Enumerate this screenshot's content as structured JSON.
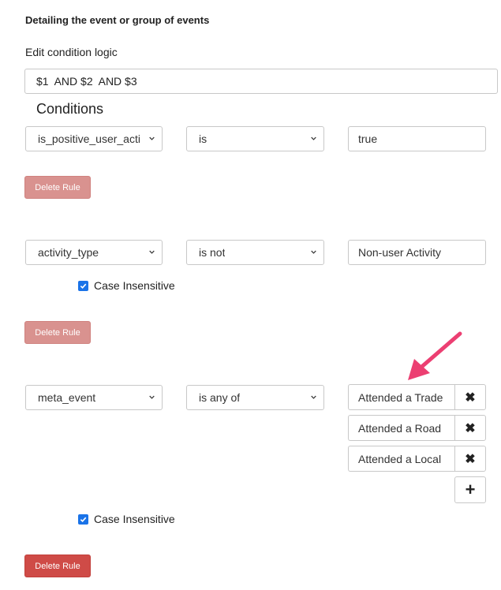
{
  "panel": {
    "title": "Detailing the event or group of events",
    "logic_label": "Edit condition logic",
    "logic_value": "$1  AND $2  AND $3",
    "conditions_title": "Conditions"
  },
  "rules": [
    {
      "field": "is_positive_user_acti",
      "operator": "is",
      "value": "true",
      "delete_label": "Delete Rule"
    },
    {
      "field": "activity_type",
      "operator": "is not",
      "value": "Non-user Activity",
      "case_insensitive_label": "Case Insensitive",
      "delete_label": "Delete Rule"
    },
    {
      "field": "meta_event",
      "operator": "is any of",
      "values": [
        "Attended a Trade",
        "Attended a Road",
        "Attended a Local"
      ],
      "remove_icon": "✖",
      "add_icon": "+",
      "case_insensitive_label": "Case Insensitive",
      "delete_label": "Delete Rule"
    }
  ],
  "colors": {
    "delete_disabled": "#d9928f",
    "delete_active": "#cf4b47",
    "checkbox": "#1a73e8",
    "annotation_arrow": "#ec3f72"
  }
}
